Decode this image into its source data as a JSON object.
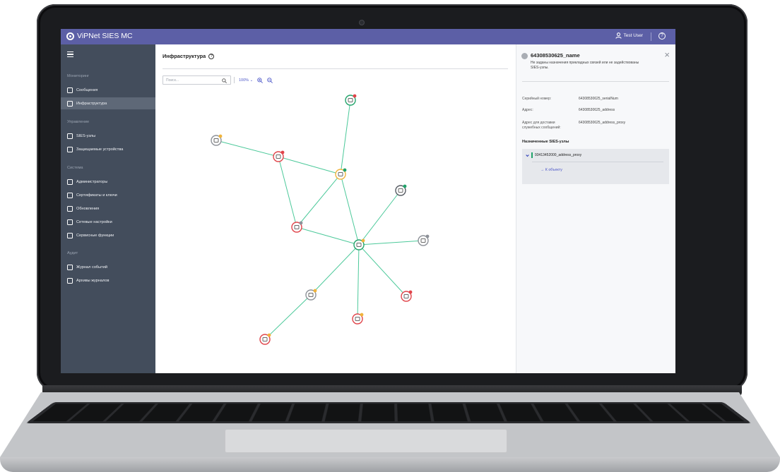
{
  "app": {
    "title": "ViPNet SIES MC",
    "user": "Test User"
  },
  "sidebar": {
    "sections": [
      {
        "label": "Мониторинг",
        "items": [
          {
            "label": "Сообщения",
            "icon": "messages-icon"
          },
          {
            "label": "Инфраструктура",
            "icon": "infrastructure-icon",
            "active": true
          }
        ]
      },
      {
        "label": "Управление",
        "items": [
          {
            "label": "SIES-узлы",
            "icon": "sies-nodes-icon"
          },
          {
            "label": "Защищаемые устройства",
            "icon": "protected-devices-icon"
          }
        ]
      },
      {
        "label": "Система",
        "items": [
          {
            "label": "Администраторы",
            "icon": "admin-icon"
          },
          {
            "label": "Сертификаты и ключи",
            "icon": "certificate-icon"
          },
          {
            "label": "Обновления",
            "icon": "updates-icon"
          },
          {
            "label": "Сетевые настройки",
            "icon": "network-icon"
          },
          {
            "label": "Сервисные функции",
            "icon": "service-icon"
          }
        ]
      },
      {
        "label": "Аудит",
        "items": [
          {
            "label": "Журнал событий",
            "icon": "event-log-icon"
          },
          {
            "label": "Архивы журналов",
            "icon": "log-archive-icon"
          }
        ]
      }
    ]
  },
  "main": {
    "title": "Инфраструктура",
    "search_placeholder": "Поиск...",
    "zoom": "100%"
  },
  "graph": {
    "colors": {
      "edge": "#4cc99a",
      "green": "#21a36a",
      "red": "#e0444a",
      "orange": "#f0b43c",
      "gray": "#8d9198",
      "dark": "#555a62"
    },
    "nodes": [
      {
        "id": "n1",
        "ring": "green",
        "dot": "red",
        "icon": "monitor-icon"
      },
      {
        "id": "n2",
        "ring": "gray",
        "dot": "orange",
        "icon": "server-icon"
      },
      {
        "id": "n3",
        "ring": "red",
        "dot": "red",
        "icon": "storage-icon"
      },
      {
        "id": "n4",
        "ring": "orange",
        "dot": "green",
        "icon": "gateway-icon"
      },
      {
        "id": "n5",
        "ring": "dark",
        "dot": "green",
        "icon": "monitor-icon"
      },
      {
        "id": "n6",
        "ring": "red",
        "dot": "gray",
        "icon": "gateway-icon"
      },
      {
        "id": "n7",
        "ring": "green",
        "dot": "orange",
        "icon": "hub-icon"
      },
      {
        "id": "n8",
        "ring": "gray",
        "dot": "gray",
        "icon": "monitor-icon"
      },
      {
        "id": "n9",
        "ring": "red",
        "dot": "red",
        "icon": "monitor-icon"
      },
      {
        "id": "n10",
        "ring": "gray",
        "dot": "orange",
        "icon": "monitor-icon"
      },
      {
        "id": "n11",
        "ring": "red",
        "dot": "orange",
        "icon": "storage-icon"
      },
      {
        "id": "n12",
        "ring": "red",
        "dot": "orange",
        "icon": "clock-icon"
      }
    ],
    "edges": [
      [
        "n1",
        "n4"
      ],
      [
        "n2",
        "n3"
      ],
      [
        "n3",
        "n4"
      ],
      [
        "n3",
        "n6"
      ],
      [
        "n4",
        "n6"
      ],
      [
        "n4",
        "n7"
      ],
      [
        "n5",
        "n7"
      ],
      [
        "n6",
        "n7"
      ],
      [
        "n7",
        "n8"
      ],
      [
        "n7",
        "n9"
      ],
      [
        "n7",
        "n10"
      ],
      [
        "n7",
        "n11"
      ],
      [
        "n10",
        "n12"
      ]
    ]
  },
  "panel": {
    "title": "64308530625_name",
    "warning": "Не заданы назначения прикладных связей или не задействованы SIES-узлы.",
    "fields": [
      {
        "key": "Серийный номер:",
        "value": "64308530625_serialNum"
      },
      {
        "key": "Адрес:",
        "value": "64308530625_address"
      },
      {
        "key": "Адрес для доставки служебных сообщений:",
        "value": "64308530625_address_proxy"
      }
    ],
    "assigned_title": "Назначенные SIES-узлы",
    "assigned_item": "93413452000_address_proxy",
    "goto_label": "→ К объекту"
  }
}
